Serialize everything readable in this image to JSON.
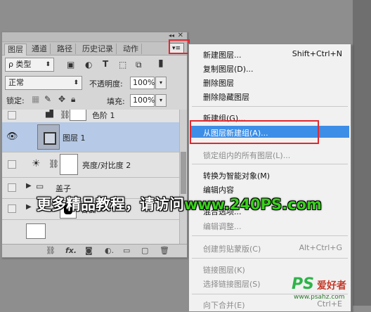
{
  "panel": {
    "tabs": [
      "图层",
      "通道",
      "路径",
      "历史记录",
      "动作"
    ],
    "menu_button_glyph": "▾≡",
    "filter": {
      "kind_label": "ρ 类型"
    },
    "blend_mode": "正常",
    "opacity_label": "不透明度:",
    "opacity_value": "100%",
    "lock_label": "锁定:",
    "fill_label": "填充:",
    "fill_value": "100%",
    "layers": [
      {
        "name": "色阶 1",
        "visible": false
      },
      {
        "name": "图层 1",
        "visible": true,
        "selected": true
      },
      {
        "name": "亮度/对比度 2",
        "visible": false
      },
      {
        "name": "盖子",
        "visible": false
      },
      {
        "name": "鲁器",
        "visible": false
      }
    ],
    "footer_icons": [
      "link-icon",
      "fx-icon",
      "mask-icon",
      "adjustment-icon",
      "group-icon",
      "new-layer-icon",
      "trash-icon"
    ]
  },
  "menu": {
    "items": [
      {
        "label": "新建图层...",
        "shortcut": "Shift+Ctrl+N",
        "disabled": false
      },
      {
        "label": "复制图层(D)...",
        "shortcut": "",
        "disabled": false
      },
      {
        "label": "删除图层",
        "shortcut": "",
        "disabled": false
      },
      {
        "label": "删除隐藏图层",
        "shortcut": "",
        "disabled": false
      },
      {
        "label": "新建组(G)...",
        "shortcut": "",
        "disabled": false
      },
      {
        "label": "从图层新建组(A)...",
        "shortcut": "",
        "disabled": false,
        "highlighted": true
      },
      {
        "label": "锁定组内的所有图层(L)...",
        "shortcut": "",
        "disabled": true
      },
      {
        "label": "转换为智能对象(M)",
        "shortcut": "",
        "disabled": false
      },
      {
        "label": "编辑内容",
        "shortcut": "",
        "disabled": true
      },
      {
        "label": "混合选项...",
        "shortcut": "",
        "disabled": false
      },
      {
        "label": "编辑调整...",
        "shortcut": "",
        "disabled": true
      },
      {
        "label": "创建剪贴蒙版(C)",
        "shortcut": "Alt+Ctrl+G",
        "disabled": true
      },
      {
        "label": "链接图层(K)",
        "shortcut": "",
        "disabled": true
      },
      {
        "label": "选择链接图层(S)",
        "shortcut": "",
        "disabled": true
      },
      {
        "label": "向下合并(E)",
        "shortcut": "Ctrl+E",
        "disabled": true
      }
    ]
  },
  "overlay": {
    "banner_text": "更多精品教程，请访问",
    "banner_site": "www.240PS.com",
    "brand_ps": "PS",
    "brand_sub": "爱好者",
    "brand_url": "www.psahz.com"
  },
  "colors": {
    "highlight": "#3d8ee6",
    "selected_layer": "#b6c9e6",
    "annotation_red": "#e0282f",
    "banner_site": "#39d01b"
  }
}
